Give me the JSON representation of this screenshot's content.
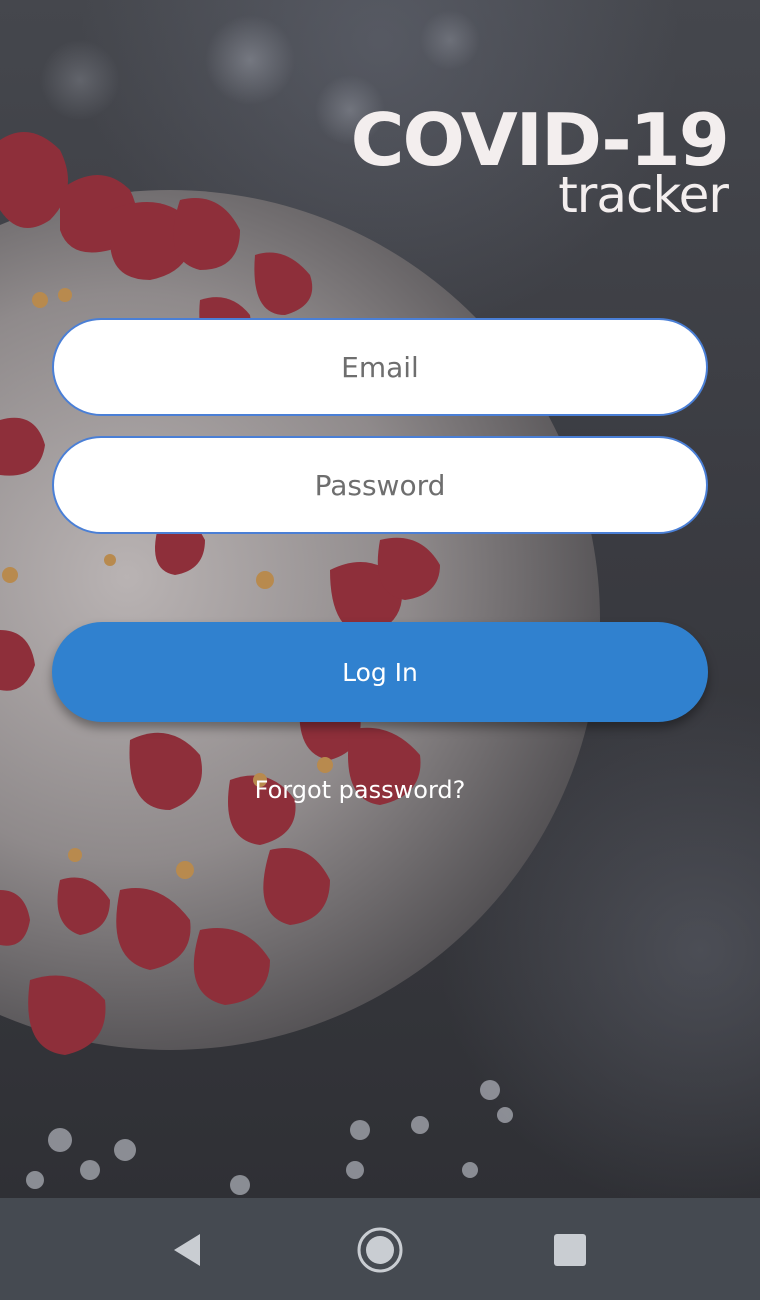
{
  "logo": {
    "main": "COVID-19",
    "sub": "tracker"
  },
  "form": {
    "email_placeholder": "Email",
    "password_placeholder": "Password",
    "login_label": "Log In",
    "forgot_label": "Forgot password?"
  },
  "navbar": {
    "back_icon": "back-triangle-icon",
    "home_icon": "home-circle-icon",
    "recent_icon": "recent-apps-square-icon"
  },
  "colors": {
    "primary_button": "#3081cf",
    "input_border": "#4a7fd6",
    "navbar": "#454a51",
    "virus_spike": "#8e2f3a"
  }
}
